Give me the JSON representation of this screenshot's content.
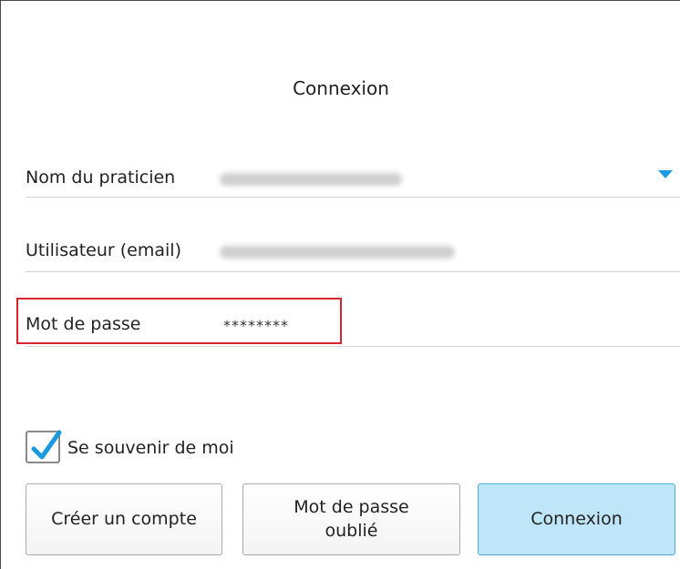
{
  "header": {
    "title": "Connexion"
  },
  "form": {
    "practitioner": {
      "label": "Nom du praticien",
      "icon": "dropdown-arrow-icon"
    },
    "user": {
      "label": "Utilisateur (email)"
    },
    "password": {
      "label": "Mot de passe",
      "value": "********"
    },
    "remember": {
      "label": "Se souvenir de moi",
      "checked": true
    }
  },
  "buttons": {
    "create_account": "Créer un compte",
    "forgot_password": "Mot de passe\noublié",
    "login": "Connexion"
  },
  "colors": {
    "accent": "#1c9ae0",
    "primary_button_bg": "#bfe6f8",
    "highlight_border": "#d9262e"
  }
}
